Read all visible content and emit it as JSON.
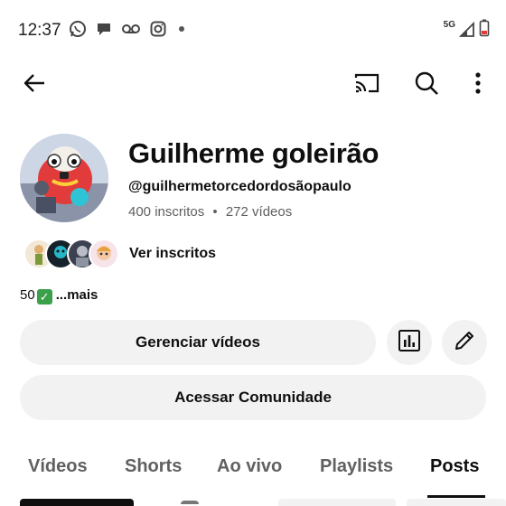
{
  "status_bar": {
    "time": "12:37",
    "network": "5G",
    "icons": [
      "whatsapp-icon",
      "chat-bubble-icon",
      "voicemail-icon",
      "instagram-icon",
      "dot-icon",
      "signal-icon",
      "battery-icon"
    ],
    "battery_color": "#e53935"
  },
  "top_bar": {
    "icons": [
      "back-arrow-icon",
      "cast-icon",
      "search-icon",
      "more-vert-icon"
    ]
  },
  "channel": {
    "name": "Guilherme goleirão",
    "handle": "@guilhermetorcedordosãopaulo",
    "subscribers": "400 inscritos",
    "separator": "•",
    "videos": "272 vídeos",
    "see_subscribers": "Ver inscritos",
    "description": "50",
    "description_more": "...mais",
    "check_glyph": "✓"
  },
  "actions": {
    "manage_videos": "Gerenciar vídeos",
    "community": "Acessar Comunidade",
    "analytics_icon": "analytics-icon",
    "edit_icon": "edit-pencil-icon"
  },
  "tabs": [
    {
      "label": "Vídeos",
      "active": false
    },
    {
      "label": "Shorts",
      "active": false
    },
    {
      "label": "Ao vivo",
      "active": false
    },
    {
      "label": "Playlists",
      "active": false
    },
    {
      "label": "Posts",
      "active": true
    }
  ],
  "colors": {
    "text": "#0f0f0f",
    "secondary": "#606060",
    "button_bg": "#f2f2f2",
    "check_green": "#3aa04a"
  }
}
